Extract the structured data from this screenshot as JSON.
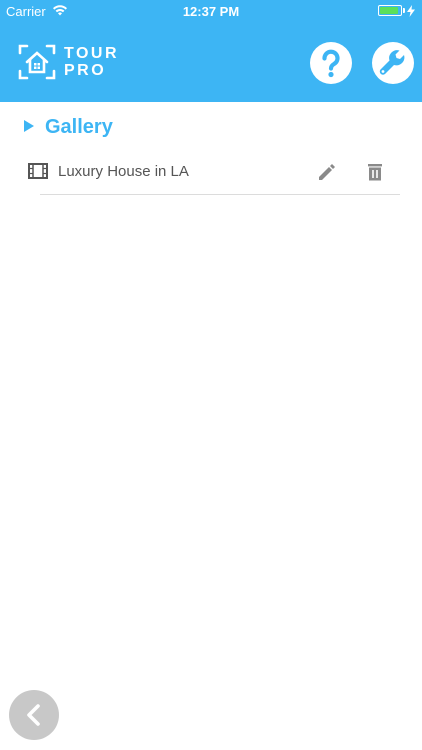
{
  "status": {
    "carrier": "Carrier",
    "time": "12:37 PM",
    "battery_level": 0.9
  },
  "header": {
    "logo_line1": "TOUR",
    "logo_line2": "PRO",
    "help_icon": "question-circle-icon",
    "tools_icon": "wrench-circle-icon"
  },
  "section": {
    "title": "Gallery",
    "icon": "triangle-right-icon"
  },
  "rows": [
    {
      "label": "Luxury House in LA",
      "icon": "film-strip-icon"
    }
  ],
  "footer": {
    "back_icon": "chevron-left-icon"
  },
  "colors": {
    "accent": "#3DB5F4",
    "battery": "#5BE05B",
    "icon_gray": "#8a8a8a"
  }
}
